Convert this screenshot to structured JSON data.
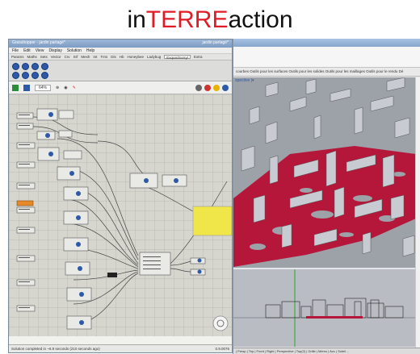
{
  "title": {
    "prefix": "in",
    "highlight": "TERRE",
    "suffix": "action"
  },
  "grasshopper": {
    "window_title": "Grasshopper - jardin partagé*",
    "doc_name": "jardin partagé*",
    "menu": [
      "File",
      "Edit",
      "View",
      "Display",
      "Solution",
      "Help"
    ],
    "tabs": [
      "Params",
      "Maths",
      "Sets",
      "Vector",
      "Crv",
      "Srf",
      "Mesh",
      "Int",
      "Trns",
      "Dis",
      "Hb",
      "Honeybee",
      "Ladybug",
      "Exquis/Sorry/",
      "Extra"
    ],
    "active_tab": "Exquis/Sorry/",
    "zoom": "64%",
    "status": "Solution completed in ~6.9 seconds (210 seconds ago)",
    "version": "0.9.0076",
    "colors": {
      "canvas": "#d6d6cf",
      "panel": "#f0e64a",
      "accent": "#2d59a8"
    }
  },
  "rhino": {
    "toolbar_text": "courbes  Outils pour les surfaces  Outils pour les solides  Outils pour les maillages  Outils pour le rendu  Dé",
    "perspective_label": "spective |▾",
    "bottom_tabs": "| Persp | Top | Front | Right | Perspective | Top(2) | Grille | Mémo | Acc | Soleil ...",
    "colors": {
      "terrain": "#b5173a",
      "buildings": "#c9cbd2",
      "viewport_bg": "#9da1a8"
    }
  }
}
